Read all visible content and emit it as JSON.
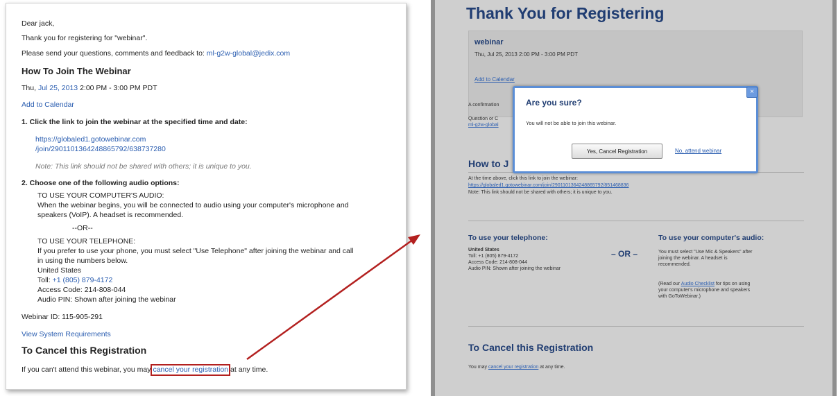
{
  "email": {
    "greeting": "Dear jack,",
    "thanks": "Thank you for registering for \"webinar\".",
    "feedback_prefix": "Please send your questions, comments and feedback to:",
    "feedback_email": "ml-g2w-global@jedix.com",
    "how_to_join_heading": "How To Join The Webinar",
    "date_prefix": "Thu,",
    "date_link": "Jul 25, 2013",
    "time_text": "2:00 PM - 3:00 PM PDT",
    "add_to_calendar": "Add to Calendar",
    "step1": "1. Click the link to join the webinar at the specified time and date:",
    "join_link_line1": "https://globaled1.gotowebinar.com",
    "join_link_line2": "/join/2901101364248865792/638737280",
    "note": "Note: This link should not be shared with others; it is unique to you.",
    "step2": "2. Choose one of the following audio options:",
    "computer_audio_heading": "TO USE YOUR COMPUTER'S AUDIO:",
    "computer_audio_line1": "When the webinar begins, you will be connected to audio using your computer's microphone and",
    "computer_audio_line2": "speakers (VoIP). A headset is recommended.",
    "or": "--OR--",
    "telephone_heading": "TO USE YOUR TELEPHONE:",
    "telephone_line1": "If you prefer to use your phone, you must select \"Use Telephone\" after joining the webinar and call",
    "telephone_line2": "in using the numbers below.",
    "country": "United States",
    "toll_prefix": "Toll:",
    "toll_number": "+1 (805) 879-4172",
    "access_code": "Access Code: 214-808-044",
    "audio_pin": "Audio PIN: Shown after joining the webinar",
    "webinar_id": "Webinar ID: 115-905-291",
    "system_requirements": "View System Requirements",
    "cancel_heading": "To Cancel this Registration",
    "cancel_prefix": "If you can't attend this webinar, you may",
    "cancel_link": "cancel your registration",
    "cancel_suffix": "at any time."
  },
  "registration_page": {
    "title": "Thank You for Registering",
    "event_name": "webinar",
    "event_time": "Thu, Jul 25, 2013 2:00 PM - 3:00 PM PDT",
    "add_to_calendar": "Add to Calendar",
    "confirmation_partial": "A confirmation",
    "questions_partial": "Question or C",
    "questions_link_partial": "ml-g2w-global",
    "how_to_join_partial": "How to J",
    "join_instructions": "At the time above, click this link to join the webinar:",
    "join_url": "https://globaled1.gotowebinar.com/join/2901101364248865792/851468836",
    "join_note": "Note: This link should not be shared with others; it is unique to you.",
    "telephone_heading": "To use your telephone:",
    "telephone_country": "United States",
    "telephone_toll": "Toll: +1 (805) 879-4172",
    "telephone_access": "Access Code: 214-808-044",
    "telephone_pin": "Audio PIN: Shown after joining the webinar",
    "or": "– OR –",
    "computer_heading": "To use your computer's audio:",
    "computer_line1": "You must select \"Use Mic & Speakers\" after",
    "computer_line2": "joining the webinar. A headset is",
    "computer_line3": "recommended.",
    "computer_line4_prefix": "(Read our",
    "computer_line4_link": "Audio Checklist",
    "computer_line4_suffix": "for tips on using",
    "computer_line5": "your computer's microphone and speakers",
    "computer_line6": "with GoToWebinar.)",
    "cancel_heading": "To Cancel this Registration",
    "cancel_prefix": "You may",
    "cancel_link": "cancel your registration",
    "cancel_suffix": "at any time."
  },
  "modal": {
    "title": "Are you sure?",
    "body": "You will not be able to join this webinar.",
    "confirm_button": "Yes, Cancel Registration",
    "decline_link": "No, attend webinar",
    "close_icon": "×"
  },
  "colors": {
    "link": "#2a5db0",
    "heading_blue": "#203d72",
    "highlight_box": "#b3201f",
    "arrow": "#b3201f",
    "modal_border": "#5b8ed6"
  }
}
